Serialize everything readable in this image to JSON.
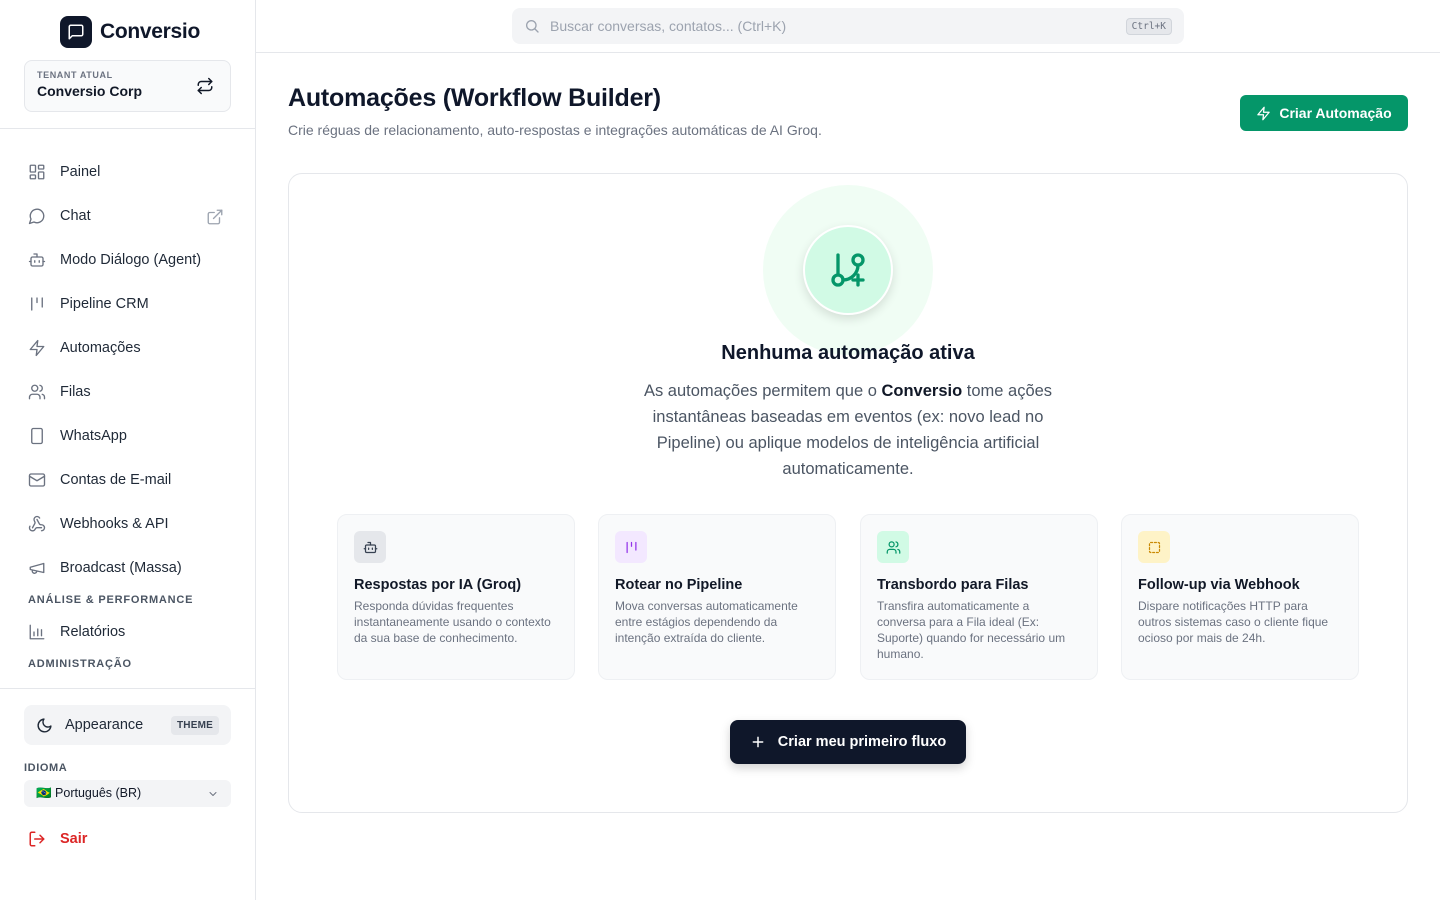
{
  "brand": {
    "name": "Conversio"
  },
  "tenant": {
    "label": "TENANT ATUAL",
    "name": "Conversio Corp"
  },
  "nav": {
    "items": [
      {
        "label": "Painel",
        "icon": "dashboard-icon"
      },
      {
        "label": "Chat",
        "icon": "chat-icon"
      },
      {
        "label": "Modo Diálogo (Agent)",
        "icon": "bot-icon"
      },
      {
        "label": "Pipeline CRM",
        "icon": "pipeline-icon"
      },
      {
        "label": "Automações",
        "icon": "lightning-icon"
      },
      {
        "label": "Filas",
        "icon": "users-icon"
      },
      {
        "label": "WhatsApp",
        "icon": "smartphone-icon"
      },
      {
        "label": "Contas de E-mail",
        "icon": "mail-icon"
      },
      {
        "label": "Webhooks & API",
        "icon": "webhook-icon"
      },
      {
        "label": "Broadcast (Massa)",
        "icon": "megaphone-icon"
      }
    ],
    "section_analysis": "ANÁLISE & PERFORMANCE",
    "reports": {
      "label": "Relatórios",
      "icon": "bar-chart-icon"
    },
    "section_admin": "ADMINISTRAÇÃO"
  },
  "footer": {
    "appearance": "Appearance",
    "theme_badge": "THEME",
    "idioma_label": "IDIOMA",
    "language": "🇧🇷 Português (BR)",
    "logout": "Sair"
  },
  "search": {
    "placeholder": "Buscar conversas, contatos... (Ctrl+K)",
    "shortcut": "Ctrl+K"
  },
  "header": {
    "title": "Automações (Workflow Builder)",
    "subtitle": "Crie réguas de relacionamento, auto-respostas e integrações automáticas de AI Groq.",
    "create_button": "Criar Automação"
  },
  "empty_state": {
    "title": "Nenhuma automação ativa",
    "desc_before": "As automações permitem que o ",
    "desc_brand": "Conversio",
    "desc_after": " tome ações instantâneas baseadas em eventos (ex: novo lead no Pipeline) ou aplique modelos de inteligência artificial automaticamente.",
    "cta": "Criar meu primeiro fluxo"
  },
  "cards": [
    {
      "title": "Respostas por IA (Groq)",
      "desc": "Responda dúvidas frequentes instantaneamente usando o contexto da sua base de conhecimento.",
      "icon": "bot-icon",
      "color": "#374151",
      "bg": "#e5e7eb"
    },
    {
      "title": "Rotear no Pipeline",
      "desc": "Mova conversas automaticamente entre estágios dependendo da intenção extraída do cliente.",
      "icon": "pipeline-icon",
      "color": "#9333ea",
      "bg": "#f3e8ff"
    },
    {
      "title": "Transbordo para Filas",
      "desc": "Transfira automaticamente a conversa para a Fila ideal (Ex: Suporte) quando for necessário um humano.",
      "icon": "users-icon",
      "color": "#059669",
      "bg": "#d1fae5"
    },
    {
      "title": "Follow-up via Webhook",
      "desc": "Dispare notificações HTTP para outros sistemas caso o cliente fique ocioso por mais de 24h.",
      "icon": "dashed-square-icon",
      "color": "#ca8a04",
      "bg": "#fef3c7"
    }
  ],
  "colors": {
    "accent": "#059669",
    "dark": "#0f172a",
    "danger": "#dc2626"
  }
}
